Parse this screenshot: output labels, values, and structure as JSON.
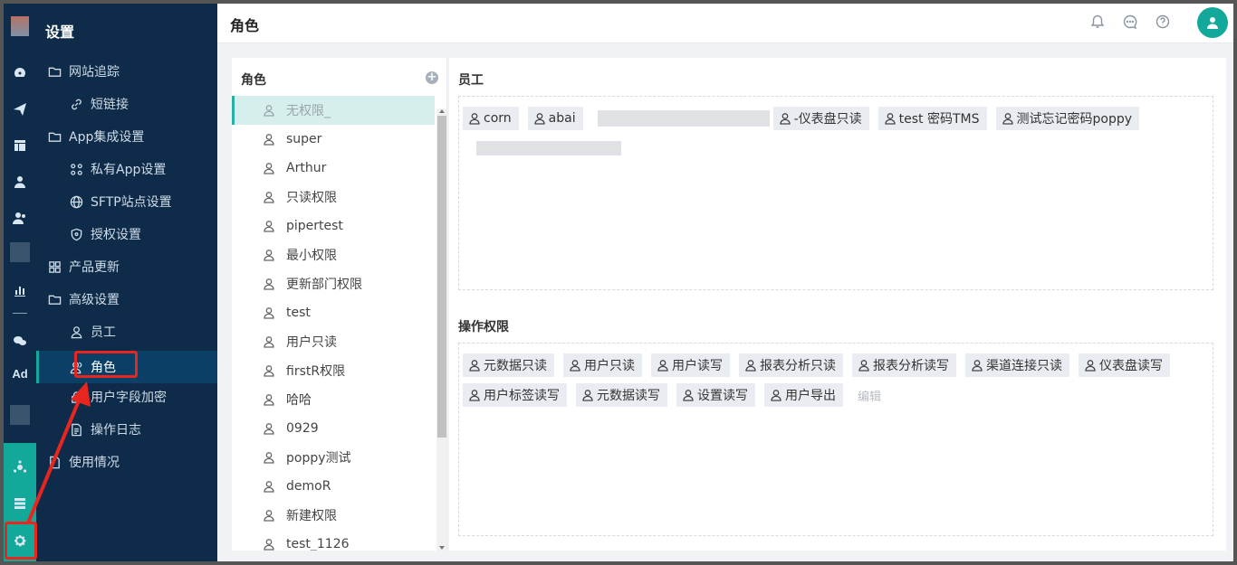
{
  "sidebar": {
    "title": "设置",
    "items": [
      {
        "label": "网站追踪",
        "icon": "folder-icon"
      },
      {
        "label": "短链接",
        "icon": "link-icon"
      },
      {
        "label": "App集成设置",
        "icon": "folder-icon"
      },
      {
        "label": "私有App设置",
        "icon": "grid-icon"
      },
      {
        "label": "SFTP站点设置",
        "icon": "globe-icon"
      },
      {
        "label": "授权设置",
        "icon": "shield-icon"
      },
      {
        "label": "产品更新",
        "icon": "grid-icon"
      },
      {
        "label": "高级设置",
        "icon": "folder-icon"
      },
      {
        "label": "员工",
        "icon": "user-icon"
      },
      {
        "label": "角色",
        "icon": "users-icon"
      },
      {
        "label": "用户字段加密",
        "icon": "lock-icon"
      },
      {
        "label": "操作日志",
        "icon": "doc-icon"
      },
      {
        "label": "使用情况",
        "icon": "doc-icon"
      }
    ]
  },
  "rail": {
    "ad_label": "Ad"
  },
  "header": {
    "title": "角色"
  },
  "roles": {
    "header": "角色",
    "add_label": "+",
    "items": [
      "无权限_",
      "super",
      "Arthur",
      "只读权限",
      "pipertest",
      "最小权限",
      "更新部门权限",
      "test",
      "用户只读",
      "firstR权限",
      "哈哈",
      "0929",
      "poppy测试",
      "demoR",
      "新建权限",
      "test_1126"
    ]
  },
  "detail": {
    "employees_label": "员工",
    "employees": [
      "corn",
      "abai",
      "-仪表盘只读",
      "test 密码TMS",
      "测试忘记密码poppy"
    ],
    "permissions_label": "操作权限",
    "permissions": [
      "元数据只读",
      "用户只读",
      "用户读写",
      "报表分析只读",
      "报表分析读写",
      "渠道连接只读",
      "仪表盘读写",
      "用户标签读写",
      "元数据读写",
      "设置读写",
      "用户导出"
    ],
    "edit_label": "编辑"
  },
  "colors": {
    "sidebar_bg": "#0e2c4a",
    "accent_teal": "#13a99a",
    "highlight_red": "#e8261f",
    "selected_role_bg": "#d7efec"
  }
}
